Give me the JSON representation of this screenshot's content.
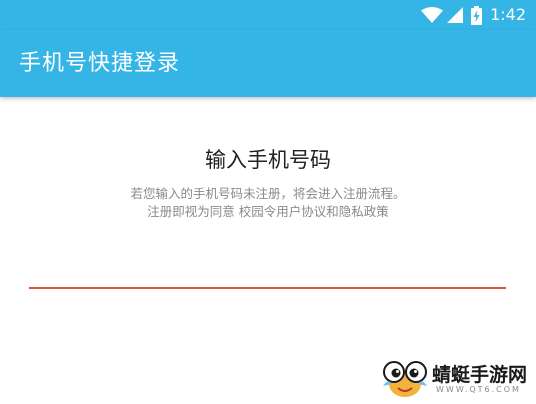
{
  "status_bar": {
    "time": "1:42",
    "icons": [
      "wifi-icon",
      "signal-icon",
      "battery-charging-icon"
    ],
    "color": "#35b4e6"
  },
  "app_bar": {
    "title": "手机号快捷登录",
    "color": "#35b4e6"
  },
  "main": {
    "heading": "输入手机号码",
    "description_line1": "若您输入的手机号码未注册，将会进入注册流程。",
    "description_line2": "注册即视为同意 校园令用户协议和隐私政策",
    "phone_input": {
      "value": "",
      "placeholder": "",
      "underline_color": "#e0533e"
    }
  },
  "watermark": {
    "text": "蜻蜓手游网",
    "url": "WWW.QT6.COM",
    "icon": "dragonfly-logo-icon"
  }
}
